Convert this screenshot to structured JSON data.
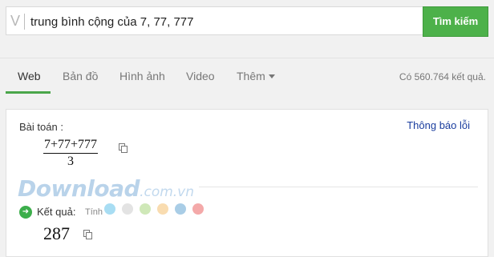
{
  "search": {
    "logo_letter": "V",
    "query": "trung bình cộng của 7, 77, 777",
    "button_label": "Tìm kiếm"
  },
  "tabs": [
    {
      "label": "Web",
      "active": true
    },
    {
      "label": "Bản đồ",
      "active": false
    },
    {
      "label": "Hình ảnh",
      "active": false
    },
    {
      "label": "Video",
      "active": false
    },
    {
      "label": "Thêm",
      "active": false
    }
  ],
  "result_count": "Có 560.764 kết quả.",
  "card": {
    "problem_label": "Bài toán :",
    "report_link": "Thông báo lỗi",
    "numerator": "7+77+777",
    "denominator": "3",
    "watermark_main": "Download",
    "watermark_domain": ".com.vn",
    "result_label": "Kết quả:",
    "calc_label": "Tính",
    "answer": "287",
    "color_dots": [
      "#a8ddf3",
      "#e3e3e3",
      "#cfe8b8",
      "#f9dcb0",
      "#a9cde6",
      "#f4a9a9"
    ]
  }
}
